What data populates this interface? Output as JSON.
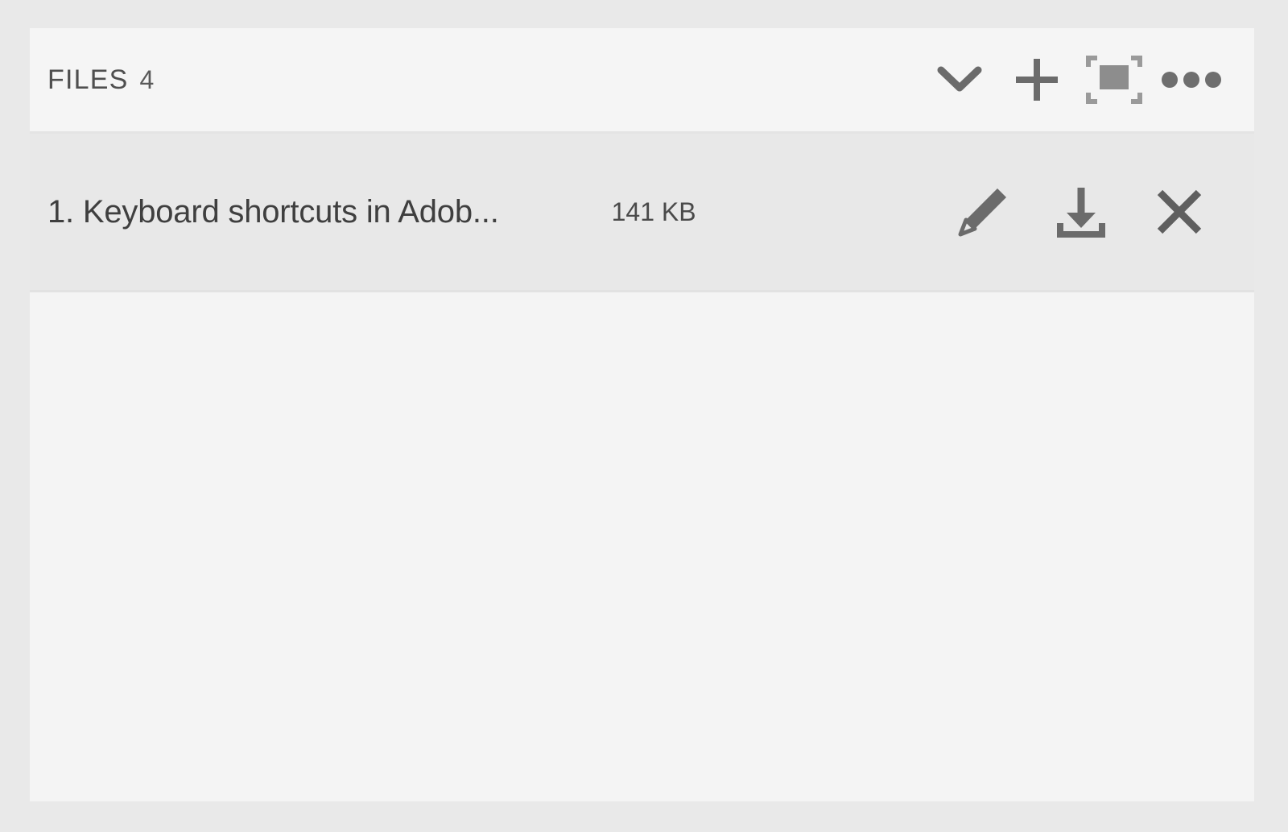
{
  "panel": {
    "header": {
      "title": "FILES",
      "count": "4",
      "actions": [
        {
          "name": "chevron-down-icon",
          "label": "Collapse"
        },
        {
          "name": "plus-icon",
          "label": "Add file"
        },
        {
          "name": "select-frame-icon",
          "label": "Select all"
        },
        {
          "name": "more-options-icon",
          "label": "More options"
        }
      ]
    },
    "files": [
      {
        "name": "1. Keyboard shortcuts in Adob...",
        "size": "141 KB",
        "actions": [
          {
            "name": "pencil-icon",
            "label": "Edit"
          },
          {
            "name": "download-icon",
            "label": "Download"
          },
          {
            "name": "close-icon",
            "label": "Remove"
          }
        ]
      }
    ],
    "colors": {
      "panel_background": "#f4f4f4",
      "header_background": "#f5f5f5",
      "row_background": "#e8e8e8",
      "page_background": "#e9e9e9",
      "icon_gray": "#6e6e6e",
      "text_dark": "#3f3f3f"
    }
  }
}
